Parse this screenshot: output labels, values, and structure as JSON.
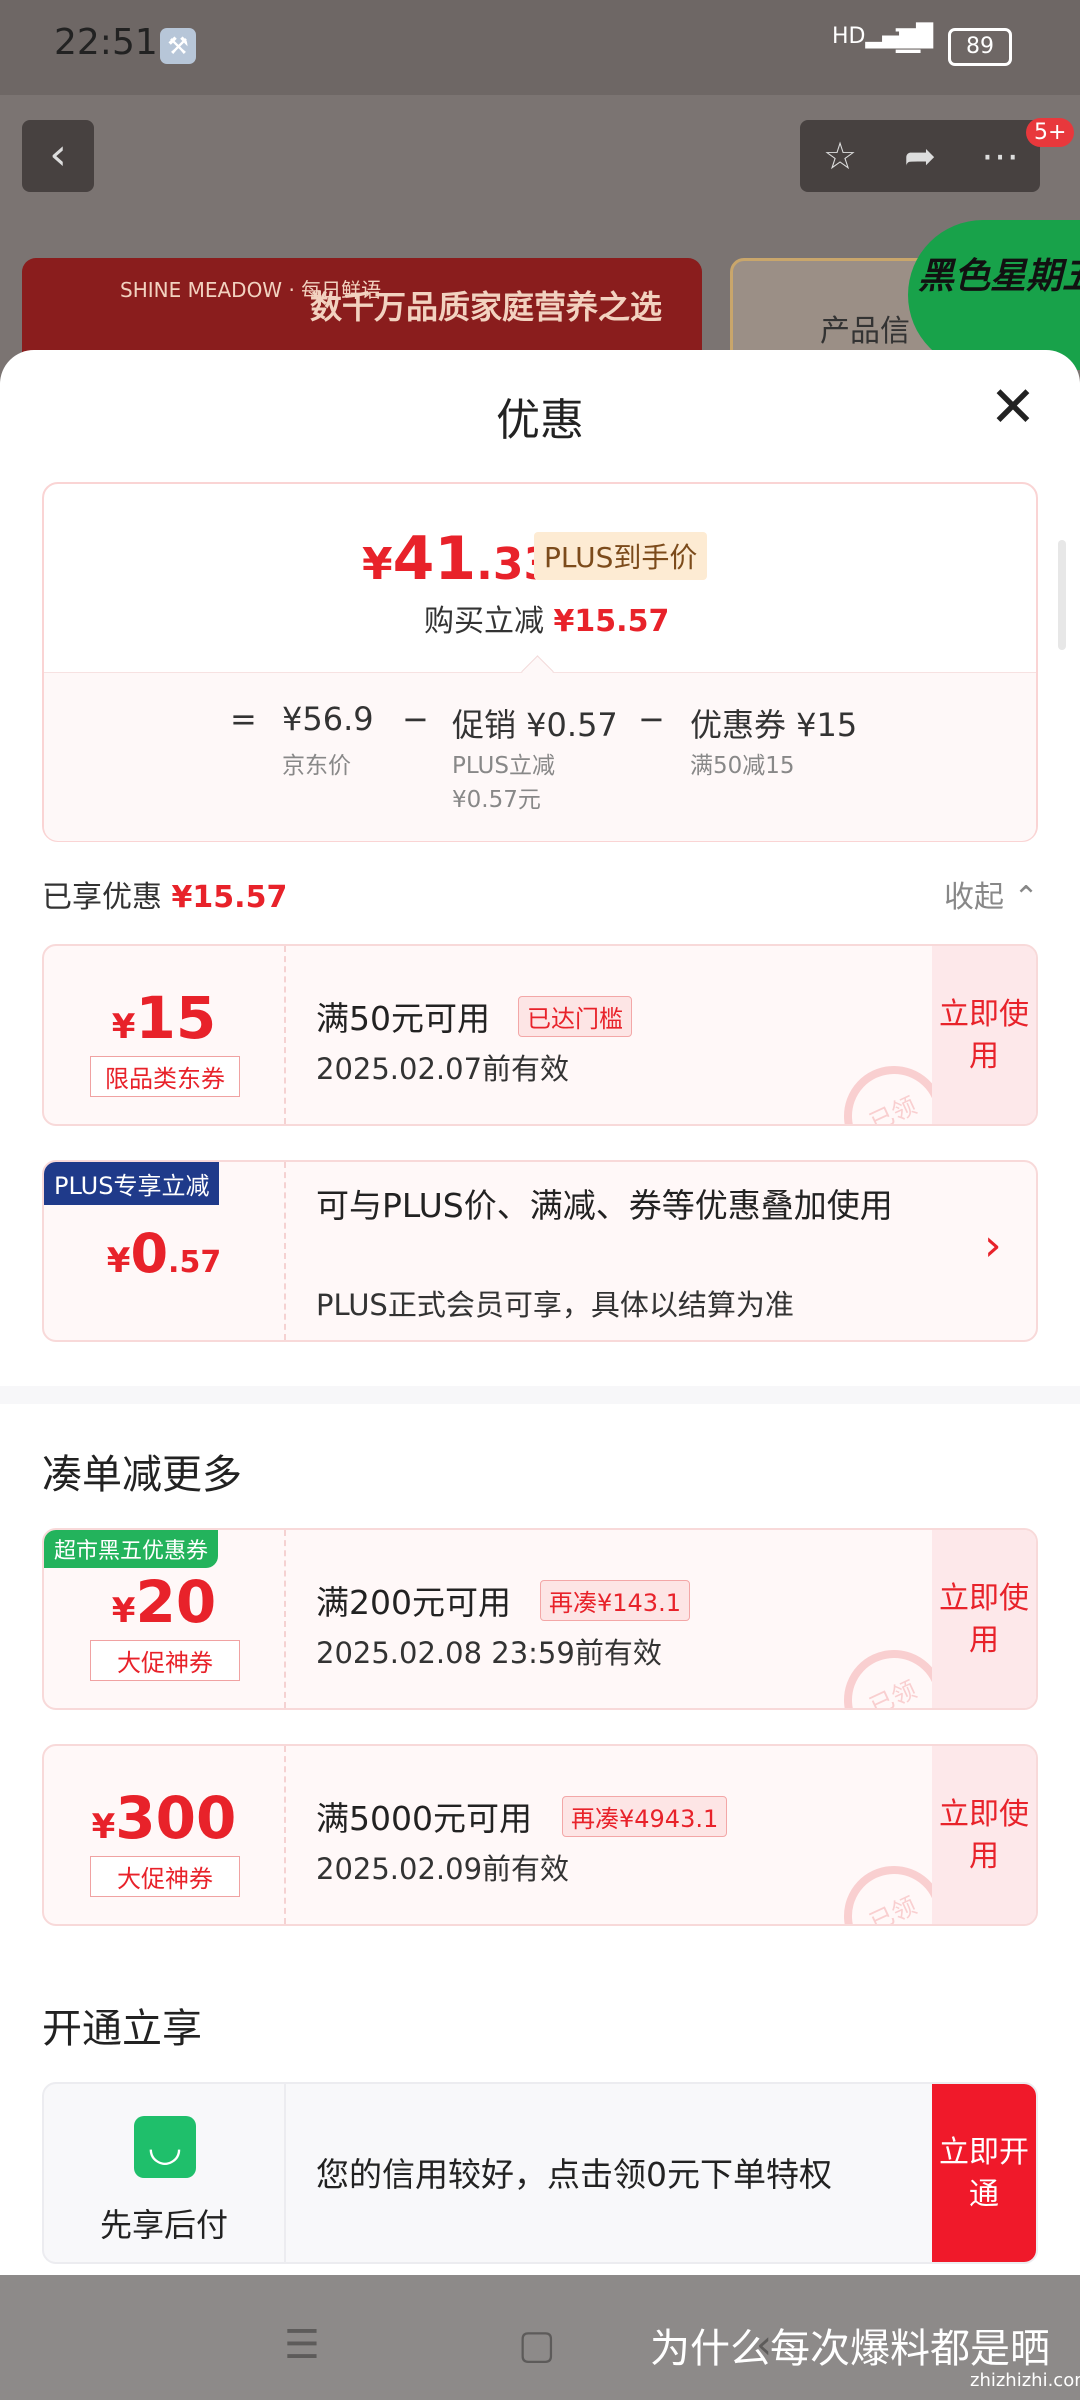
{
  "status_bar": {
    "time": "22:51",
    "signal": "HD",
    "battery": "89"
  },
  "background_header": {
    "badge": "5+",
    "banner_left_text": "数千万品质家庭营养之选",
    "banner_left_logo": "SHINE MEADOW · 每日鲜语",
    "banner_right_text": "产品信",
    "black_friday_badge": "黑色星期五"
  },
  "sheet": {
    "title": "优惠",
    "summary": {
      "price_symbol": "¥",
      "price_int": "41",
      "price_dec": ".33",
      "plus_label": "PLUS到手价",
      "buy_reduce_label": "购买立减",
      "buy_reduce_value": "¥15.57",
      "equals": "=",
      "jd_price": "¥56.9",
      "jd_price_label": "京东价",
      "minus1": "−",
      "promo": "促销 ¥0.57",
      "promo_sub1": "PLUS立减",
      "promo_sub2": "¥0.57元",
      "minus2": "−",
      "coupon": "优惠券 ¥15",
      "coupon_sub": "满50减15"
    },
    "enjoyed": {
      "label": "已享优惠",
      "value": "¥15.57",
      "collapse": "收起"
    },
    "coupons_enjoyed": [
      {
        "currency": "¥",
        "amount": "15",
        "tag": "限品类东券",
        "title": "满50元可用",
        "chip": "已达门槛",
        "date": "2025.02.07前有效",
        "button": "立即使用",
        "stamp": "已领"
      }
    ],
    "plus_card": {
      "corner": "PLUS专享立减",
      "currency": "¥",
      "amount_int": "0",
      "amount_dec": ".57",
      "title": "可与PLUS价、满减、券等优惠叠加使用",
      "desc": "PLUS正式会员可享，具体以结算为准",
      "arrow": "›"
    },
    "more_section": {
      "heading": "凑单减更多",
      "coupons": [
        {
          "corner": "超市黑五优惠券",
          "currency": "¥",
          "amount": "20",
          "tag": "大促神券",
          "title": "满200元可用",
          "chip": "再凑¥143.1",
          "date": "2025.02.08 23:59前有效",
          "button": "立即使用",
          "stamp": "已领"
        },
        {
          "corner": "",
          "currency": "¥",
          "amount": "300",
          "tag": "大促神券",
          "title": "满5000元可用",
          "chip": "再凑¥4943.1",
          "date": "2025.02.09前有效",
          "button": "立即使用",
          "stamp": "已领"
        }
      ]
    },
    "open_section": {
      "heading": "开通立享",
      "service_name": "先享后付",
      "desc": "您的信用较好，点击领0元下单特权",
      "button": "立即开通"
    }
  },
  "bottom": {
    "watermark": "为什么每次爆料都是晒",
    "watermark_site": "zhizhizhi.com"
  },
  "icons": [
    "back-icon",
    "star-icon",
    "share-icon",
    "more-icon",
    "close-icon",
    "chevron-up-icon",
    "chevron-right-icon",
    "shopping-bag-icon",
    "menu-icon",
    "home-square-icon",
    "back-nav-icon",
    "wrench-icon",
    "wifi-icon"
  ],
  "colors": {
    "accent_red": "#e8222a",
    "plus_tag_bg": "#fdebd3",
    "coupon_bg": "#fff8f8",
    "button_bg": "#fde8ea",
    "green": "#1fbf6b"
  }
}
